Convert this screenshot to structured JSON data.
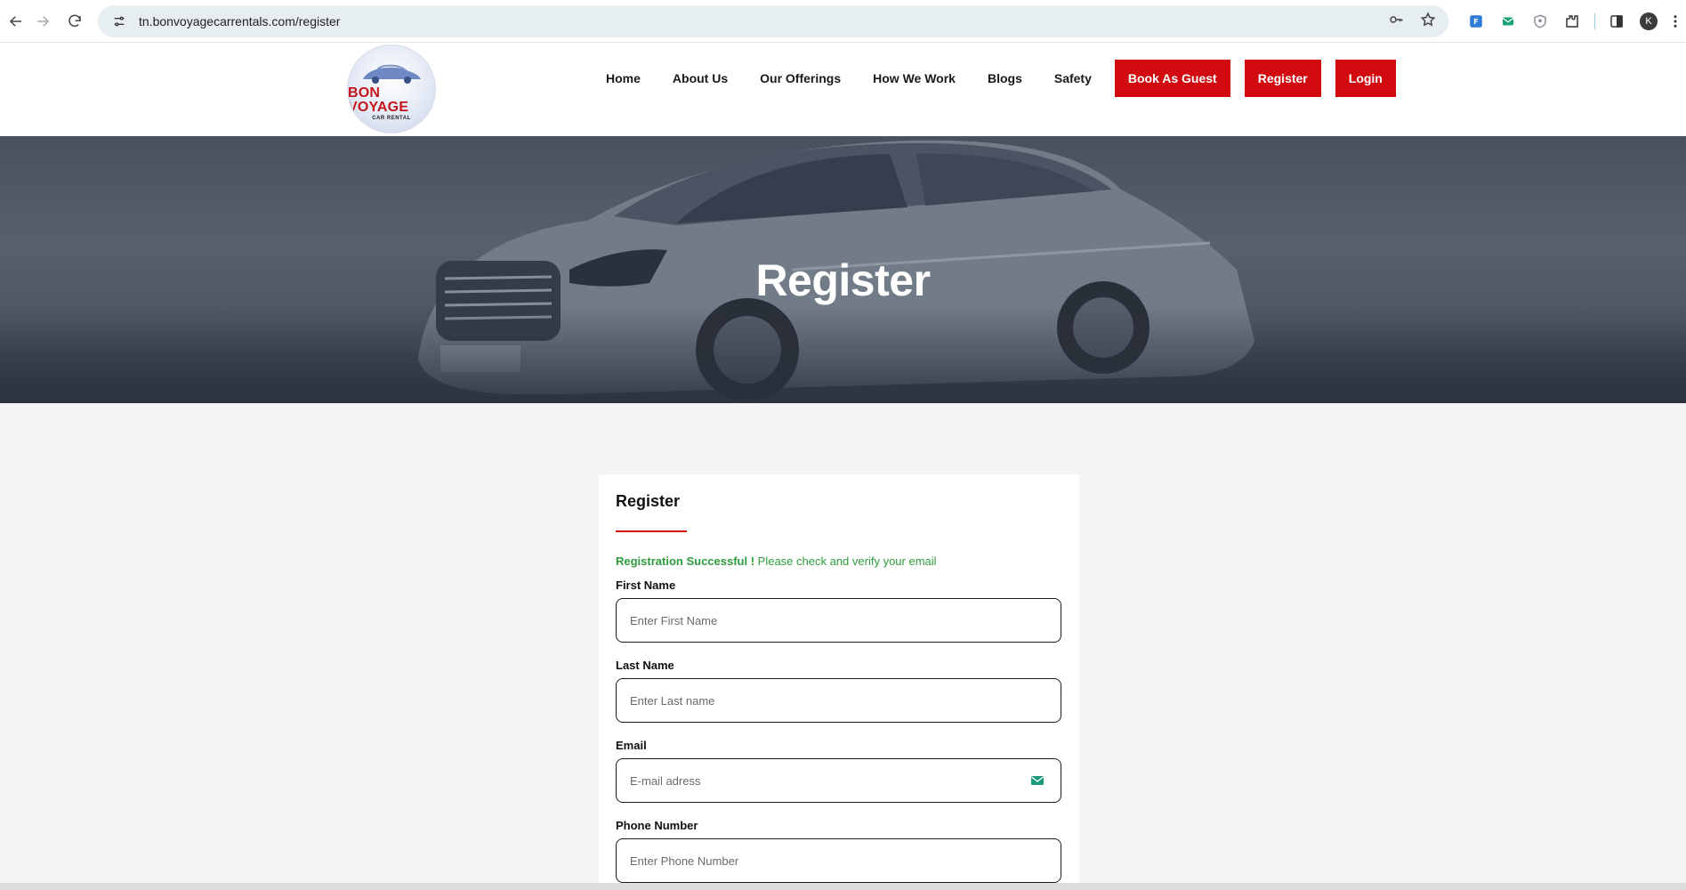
{
  "browser": {
    "url": "tn.bonvoyagecarrentals.com/register",
    "profile_initial": "K"
  },
  "site": {
    "logo": {
      "brand": "BON VOYAGE",
      "tagline": "CAR RENTAL"
    },
    "nav": {
      "links": [
        "Home",
        "About Us",
        "Our Offerings",
        "How We Work",
        "Blogs",
        "Safety"
      ],
      "cta": [
        "Book As Guest",
        "Register",
        "Login"
      ]
    },
    "accent_color": "#d10a10"
  },
  "hero": {
    "title": "Register"
  },
  "form": {
    "title": "Register",
    "success_strong": "Registration Successful !",
    "success_text": " Please check and verify your email",
    "success_color": "#2e9b3c",
    "fields": [
      {
        "label": "First Name",
        "placeholder": "Enter First Name"
      },
      {
        "label": "Last Name",
        "placeholder": "Enter Last name"
      },
      {
        "label": "Email",
        "placeholder": "E-mail adress",
        "icon": "mail-icon"
      },
      {
        "label": "Phone Number",
        "placeholder": "Enter Phone Number"
      }
    ]
  }
}
